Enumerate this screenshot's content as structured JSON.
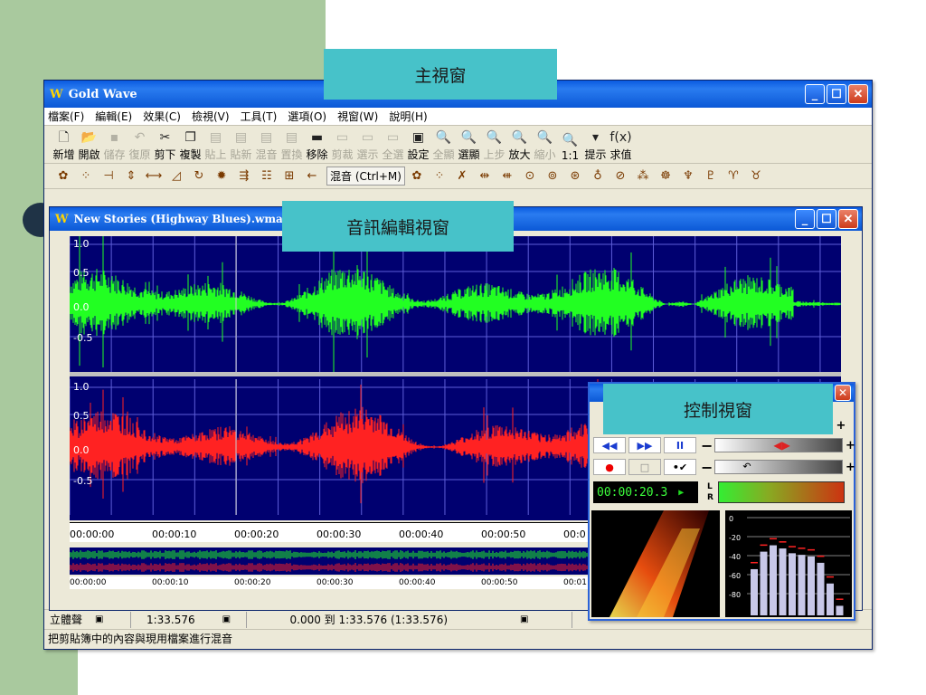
{
  "app_title": "Gold Wave",
  "menu": [
    "檔案(F)",
    "編輯(E)",
    "效果(C)",
    "檢視(V)",
    "工具(T)",
    "選項(O)",
    "視窗(W)",
    "說明(H)"
  ],
  "toolbar": [
    {
      "icon": "new-file-icon",
      "glyph": "🗋",
      "label": "新增",
      "enabled": true
    },
    {
      "icon": "open-folder-icon",
      "glyph": "📂",
      "label": "開啟",
      "enabled": true
    },
    {
      "icon": "save-icon",
      "glyph": "▪",
      "label": "儲存",
      "enabled": false
    },
    {
      "icon": "undo-icon",
      "glyph": "↶",
      "label": "復原",
      "enabled": false
    },
    {
      "icon": "cut-icon",
      "glyph": "✂",
      "label": "剪下",
      "enabled": true
    },
    {
      "icon": "copy-icon",
      "glyph": "❐",
      "label": "複製",
      "enabled": true
    },
    {
      "icon": "paste-icon",
      "glyph": "▤",
      "label": "貼上",
      "enabled": false
    },
    {
      "icon": "paste-new-icon",
      "glyph": "▤",
      "label": "貼新",
      "enabled": false
    },
    {
      "icon": "mix-icon",
      "glyph": "▤",
      "label": "混音",
      "enabled": false
    },
    {
      "icon": "replace-icon",
      "glyph": "▤",
      "label": "置換",
      "enabled": false
    },
    {
      "icon": "delete-icon",
      "glyph": "▬",
      "label": "移除",
      "enabled": true
    },
    {
      "icon": "trim-icon",
      "glyph": "▭",
      "label": "剪裁",
      "enabled": false
    },
    {
      "icon": "select-view-icon",
      "glyph": "▭",
      "label": "選示",
      "enabled": false
    },
    {
      "icon": "select-all-icon",
      "glyph": "▭",
      "label": "全選",
      "enabled": false
    },
    {
      "icon": "settings-icon",
      "glyph": "▣",
      "label": "設定",
      "enabled": true
    },
    {
      "icon": "show-all-icon",
      "glyph": "🔍",
      "label": "全顯",
      "enabled": false
    },
    {
      "icon": "show-selection-icon",
      "glyph": "🔍",
      "label": "選顯",
      "enabled": true
    },
    {
      "icon": "previous-icon",
      "glyph": "🔍",
      "label": "上步",
      "enabled": false
    },
    {
      "icon": "zoom-in-icon",
      "glyph": "🔍",
      "label": "放大",
      "enabled": true
    },
    {
      "icon": "zoom-out-icon",
      "glyph": "🔍",
      "label": "縮小",
      "enabled": false
    },
    {
      "icon": "zoom-1to1-icon",
      "glyph": "🔍",
      "label": "1:1",
      "enabled": true
    },
    {
      "icon": "cue-icon",
      "glyph": "▾",
      "label": "提示",
      "enabled": true
    },
    {
      "icon": "evaluate-icon",
      "glyph": "f(x)",
      "label": "求值",
      "enabled": true
    }
  ],
  "mix_button": "混音 (Ctrl+M)",
  "doc_title": "New Stories (Highway Blues).wma",
  "y_labels": [
    "1.0",
    "0.5",
    "0.0",
    "-0.5"
  ],
  "timeline_labels": [
    "00:00:00",
    "00:00:10",
    "00:00:20",
    "00:00:30",
    "00:00:40",
    "00:00:50",
    "00:0"
  ],
  "overview_labels": [
    "00:00:00",
    "00:00:10",
    "00:00:20",
    "00:00:30",
    "00:00:40",
    "00:00:50",
    "00:01"
  ],
  "status": {
    "channels": "立體聲",
    "length": "1:33.576",
    "selection": "0.000 到 1:33.576 (1:33.576)",
    "hint": "把剪貼簿中的內容與現用檔案進行混音"
  },
  "control": {
    "time": "00:00:20.3",
    "lr": [
      "L",
      "R"
    ],
    "db_labels": [
      "0",
      "-20",
      "-40",
      "-60",
      "-80"
    ],
    "bars": [
      0.58,
      0.8,
      0.88,
      0.84,
      0.78,
      0.76,
      0.74,
      0.66,
      0.4,
      0.12
    ]
  },
  "labels": {
    "main": "主視窗",
    "edit": "音訊編輯視窗",
    "control": "控制視窗"
  },
  "colors": {
    "left_wave": "#22ff22",
    "right_wave": "#ff2222",
    "wave_bg": "#000070",
    "label_bg": "#47c2c9"
  }
}
